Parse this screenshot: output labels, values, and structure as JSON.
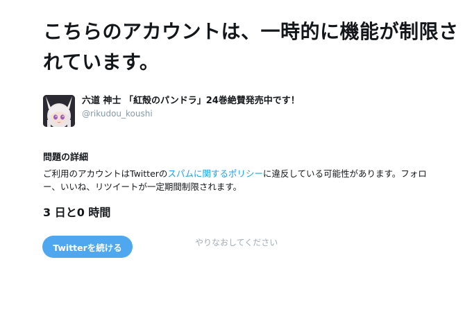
{
  "headline": "こちらのアカウントは、一時的に機能が制限されています。",
  "account": {
    "display_name": "六道 神士 「紅殻のパンドラ」24巻絶賛発売中です！",
    "handle": "@rikudou_koushi",
    "avatar_icon": "user-avatar"
  },
  "details": {
    "title": "問題の詳細",
    "body_before": "ご利用のアカウントはTwitterの",
    "policy_link": "スパムに関するポリシー",
    "body_after": "に違反している可能性があります。フォロー、いいね、リツイートが一定期間制限されます。"
  },
  "duration": "3 日と0 時間",
  "actions": {
    "continue_label": "Twitterを続ける",
    "retry_label": "やりなおしてください"
  },
  "colors": {
    "accent": "#1da1f2",
    "button_bg": "#4fa8ef",
    "muted": "#8899a6"
  }
}
